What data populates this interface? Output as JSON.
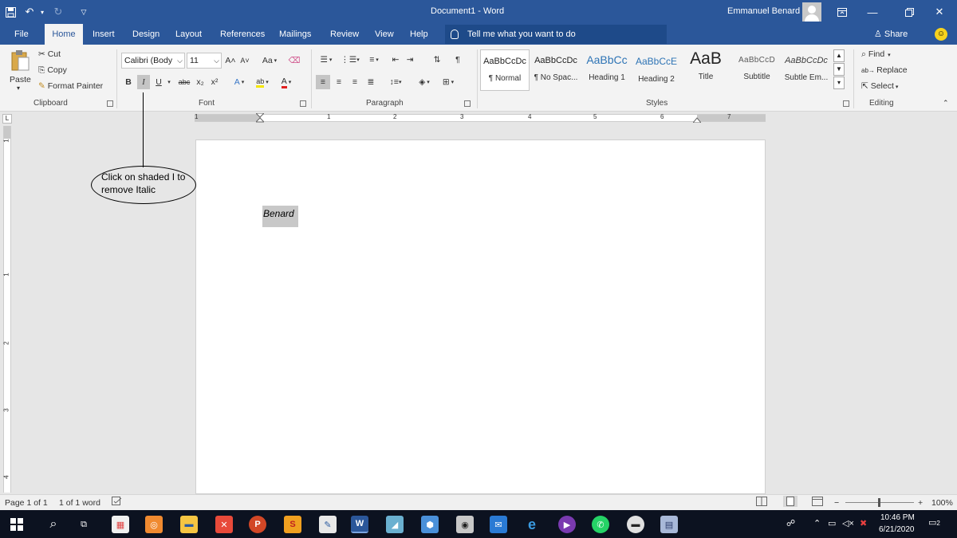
{
  "titlebar": {
    "title": "Document1  -  Word",
    "user": "Emmanuel Benard"
  },
  "tabs": [
    "File",
    "Home",
    "Insert",
    "Design",
    "Layout",
    "References",
    "Mailings",
    "Review",
    "View",
    "Help"
  ],
  "active_tab": "Home",
  "tell_me": "Tell me what you want to do",
  "share": "Share",
  "clipboard": {
    "paste": "Paste",
    "cut": "Cut",
    "copy": "Copy",
    "format_painter": "Format Painter",
    "label": "Clipboard"
  },
  "font": {
    "name": "Calibri (Body",
    "size": "11",
    "label": "Font",
    "bold": "B",
    "italic": "I",
    "underline": "U",
    "strike": "abc",
    "sub": "x₂",
    "sup": "x²",
    "change_case": "Aa",
    "grow": "A˄",
    "shrink": "A˅"
  },
  "paragraph": {
    "label": "Paragraph"
  },
  "styles": {
    "label": "Styles",
    "items": [
      {
        "sample": "AaBbCcDc",
        "name": "¶ Normal"
      },
      {
        "sample": "AaBbCcDc",
        "name": "¶ No Spac..."
      },
      {
        "sample": "AaBbCc",
        "name": "Heading 1"
      },
      {
        "sample": "AaBbCcE",
        "name": "Heading 2"
      },
      {
        "sample": "AaB",
        "name": "Title"
      },
      {
        "sample": "AaBbCcD",
        "name": "Subtitle"
      },
      {
        "sample": "AaBbCcDc",
        "name": "Subtle Em..."
      }
    ]
  },
  "editing": {
    "find": "Find",
    "replace": "Replace",
    "select": "Select",
    "label": "Editing"
  },
  "ruler": {
    "numbers": [
      "1",
      "1",
      "2",
      "3",
      "4",
      "5",
      "6",
      "7"
    ]
  },
  "vruler": {
    "numbers": [
      "1",
      "1",
      "2",
      "3",
      "4"
    ]
  },
  "document": {
    "text": "Benard"
  },
  "callout": {
    "text": "Click on shaded I to remove Italic"
  },
  "status": {
    "page": "Page 1 of 1",
    "words": "1 of 1 word",
    "zoom": "100%"
  },
  "tray": {
    "time": "10:46 PM",
    "date": "6/21/2020",
    "notifications": "2"
  },
  "colors": {
    "word_blue": "#2b579a",
    "ribbon_bg": "#f3f3f3",
    "highlight": "#c8c8c8",
    "taskbar": "#0c1220"
  }
}
